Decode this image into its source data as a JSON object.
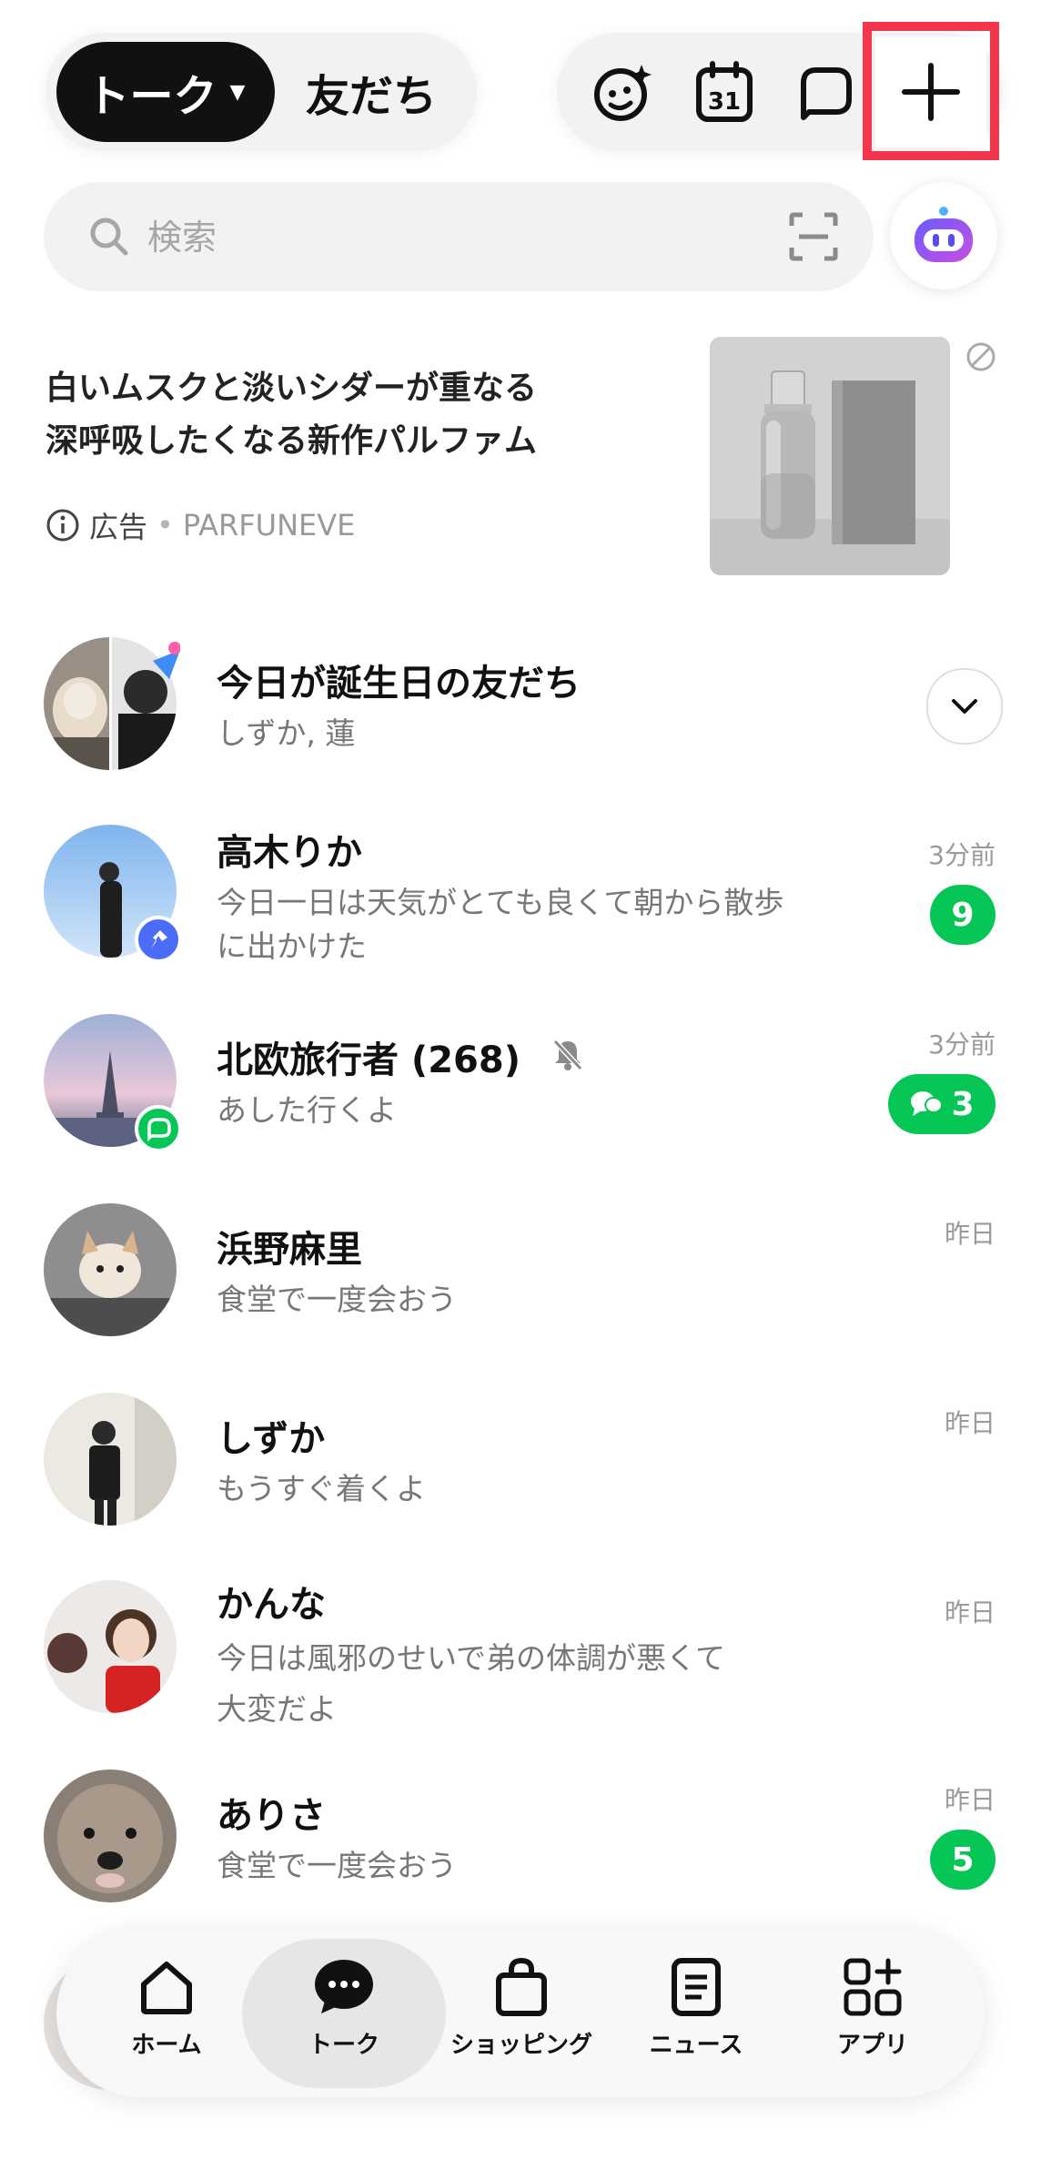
{
  "header": {
    "tab_talk": "トーク",
    "tab_friends": "友だち",
    "icons": [
      "face-sparkle-icon",
      "calendar-icon",
      "speech-bubble-icon",
      "plus-icon"
    ],
    "calendar_day": "31"
  },
  "search": {
    "placeholder": "検索"
  },
  "ad": {
    "headline_line1": "白いムスクと淡いシダーが重なる",
    "headline_line2": "深呼吸したくなる新作パルファム",
    "label": "広告",
    "advertiser": "PARFUNEVE"
  },
  "birthday": {
    "title": "今日が誕生日の友だち",
    "names": "しずか, 蓮"
  },
  "chats": [
    {
      "name": "高木りか",
      "line1": "今日一日は天気がとても良くて朝から散歩",
      "line2": "に出かけた",
      "time": "3分前",
      "badge": "9"
    },
    {
      "name": "北欧旅行者 (268)",
      "line1": "あした行くよ",
      "time": "3分前",
      "badge": "3"
    },
    {
      "name": "浜野麻里",
      "line1": "食堂で一度会おう",
      "time": "昨日"
    },
    {
      "name": "しずか",
      "line1": "もうすぐ着くよ",
      "time": "昨日"
    },
    {
      "name": "かんな",
      "line1": "今日は風邪のせいで弟の体調が悪くて",
      "line2": "大変だよ",
      "time": "昨日"
    },
    {
      "name": "ありさ",
      "line1": "食堂で一度会おう",
      "time": "昨日",
      "badge": "5"
    }
  ],
  "nav": {
    "home": "ホーム",
    "talk": "トーク",
    "shopping": "ショッピング",
    "news": "ニュース",
    "apps": "アプリ"
  },
  "colors": {
    "accent_green": "#06c755",
    "highlight_red": "#f3354d",
    "pin_blue": "#4a6cf7"
  }
}
